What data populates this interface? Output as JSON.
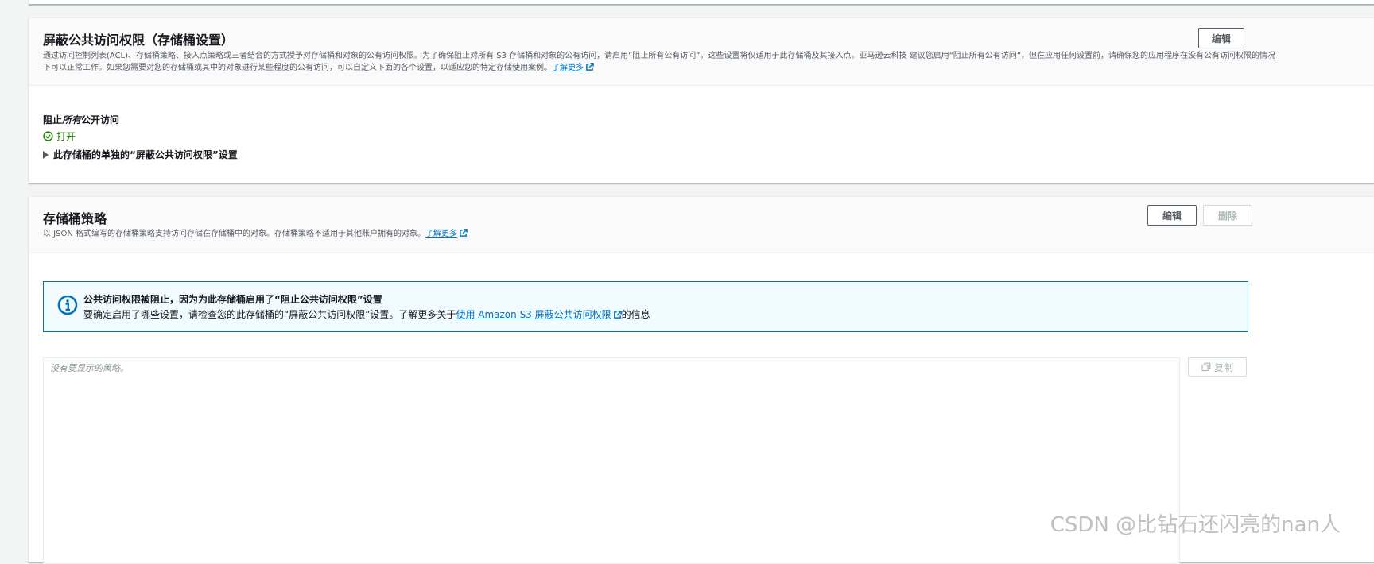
{
  "bpa_section": {
    "title": "屏蔽公共访问权限（存储桶设置）",
    "edit_label": "编辑",
    "description_line1": "通过访问控制列表(ACL)、存储桶策略、接入点策略或三者结合的方式授予对存储桶和对象的公有访问权限。为了确保阻止对所有 S3 存储桶和对象的公有访问，请启用“阻止所有公有访问”。这些设置将仅适用于此存储桶及其接入点。亚马逊云科技 建议您启用“阻止所有公有访问”，但在应用任何设置前，请确保您的应用程序在没有公有访问权限的情况",
    "description_line2": "下可以正常工作。如果您需要对您的存储桶或其中的对象进行某些程度的公有访问，可以自定义下面的各个设置，以适应您的特定存储使用案例。",
    "learn_more": "了解更多",
    "block_all_label_prefix": "阻止",
    "block_all_label_italic": "所有",
    "block_all_label_suffix": "公开访问",
    "status": "打开",
    "expander_label": "此存储桶的单独的“屏蔽公共访问权限”设置"
  },
  "policy_section": {
    "title": "存储桶策略",
    "edit_label": "编辑",
    "delete_label": "删除",
    "description": "以 JSON 格式编写的存储桶策略支持访问存储在存储桶中的对象。存储桶策略不适用于其他账户拥有的对象。",
    "learn_more": "了解更多",
    "alert": {
      "title": "公共访问权限被阻止，因为为此存储桶启用了“阻止公共访问权限”设置",
      "body_prefix": "要确定启用了哪些设置，请检查您的此存储桶的“屏蔽公共访问权限”设置。了解更多关于",
      "link_text": "使用 Amazon S3 屏蔽公共访问权限",
      "body_suffix": "的信息"
    },
    "editor_placeholder": "没有要显示的策略。",
    "copy_label": "复制"
  },
  "watermark": "CSDN @比钻石还闪亮的nan人",
  "colors": {
    "link": "#0073bb",
    "success": "#1d8102",
    "info_border": "#0073bb",
    "info_bg": "#f1faff"
  },
  "icons": {
    "status": "check-circle-icon",
    "external": "external-link-icon",
    "info": "info-circle-icon",
    "copy": "copy-icon",
    "caret": "caret-right-icon"
  }
}
